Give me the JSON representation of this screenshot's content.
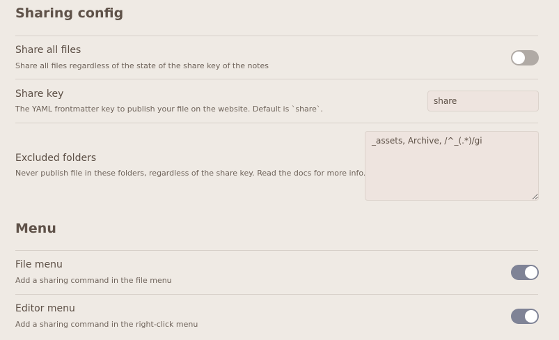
{
  "sections": {
    "sharing": {
      "title": "Sharing config",
      "share_all": {
        "name": "Share all files",
        "desc": "Share all files regardless of the state of the share key of the notes",
        "enabled": false
      },
      "share_key": {
        "name": "Share key",
        "desc": "The YAML frontmatter key to publish your file on the website. Default is `share`.",
        "value": "share"
      },
      "excluded": {
        "name": "Excluded folders",
        "desc": "Never publish file in these folders, regardless of the share key. Read the docs for more info.",
        "value": "_assets, Archive, /^_(.*)/gi"
      }
    },
    "menu": {
      "title": "Menu",
      "file_menu": {
        "name": "File menu",
        "desc": "Add a sharing command in the file menu",
        "enabled": true
      },
      "editor_menu": {
        "name": "Editor menu",
        "desc": "Add a sharing command in the right-click menu",
        "enabled": true
      }
    }
  },
  "colors": {
    "background": "#efeae4",
    "toggle_on": "#7f8396",
    "toggle_off": "#b0aaa5"
  }
}
